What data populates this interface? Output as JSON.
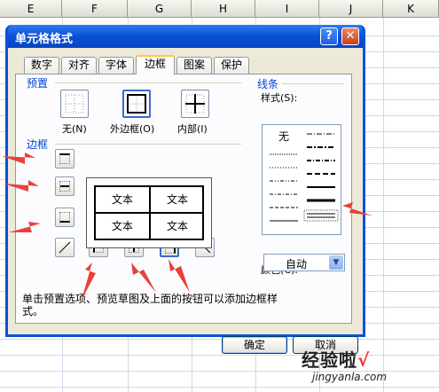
{
  "sheet": {
    "columns": [
      "E",
      "F",
      "G",
      "H",
      "I",
      "J",
      "K"
    ]
  },
  "dialog": {
    "title": "单元格格式",
    "help_label": "?",
    "close_label": "✕",
    "tabs": [
      {
        "label": "数字"
      },
      {
        "label": "对齐"
      },
      {
        "label": "字体"
      },
      {
        "label": "边框",
        "active": true
      },
      {
        "label": "图案"
      },
      {
        "label": "保护"
      }
    ],
    "presets": {
      "label": "预置",
      "none": "无(N)",
      "outline": "外边框(O)",
      "inside": "内部(I)"
    },
    "border": {
      "label": "边框",
      "preview_cells": [
        "文本",
        "文本",
        "文本",
        "文本"
      ]
    },
    "line": {
      "label": "线条",
      "style_label": "样式(S):",
      "none_label": "无",
      "color_label": "颜色(C):",
      "color_value": "自动"
    },
    "note": "单击预置选项、预览草图及上面的按钮可以添加边框样式。",
    "ok_label": "确定",
    "cancel_label": "取消"
  },
  "watermark": {
    "text": "经验啦",
    "check": "√",
    "url": "jingyanla.com"
  },
  "colors": {
    "title_bar": "#0a51d8",
    "dialog_bg": "#ece9d8",
    "annotation_arrow": "#e8403a",
    "group_label": "#0046d5"
  }
}
